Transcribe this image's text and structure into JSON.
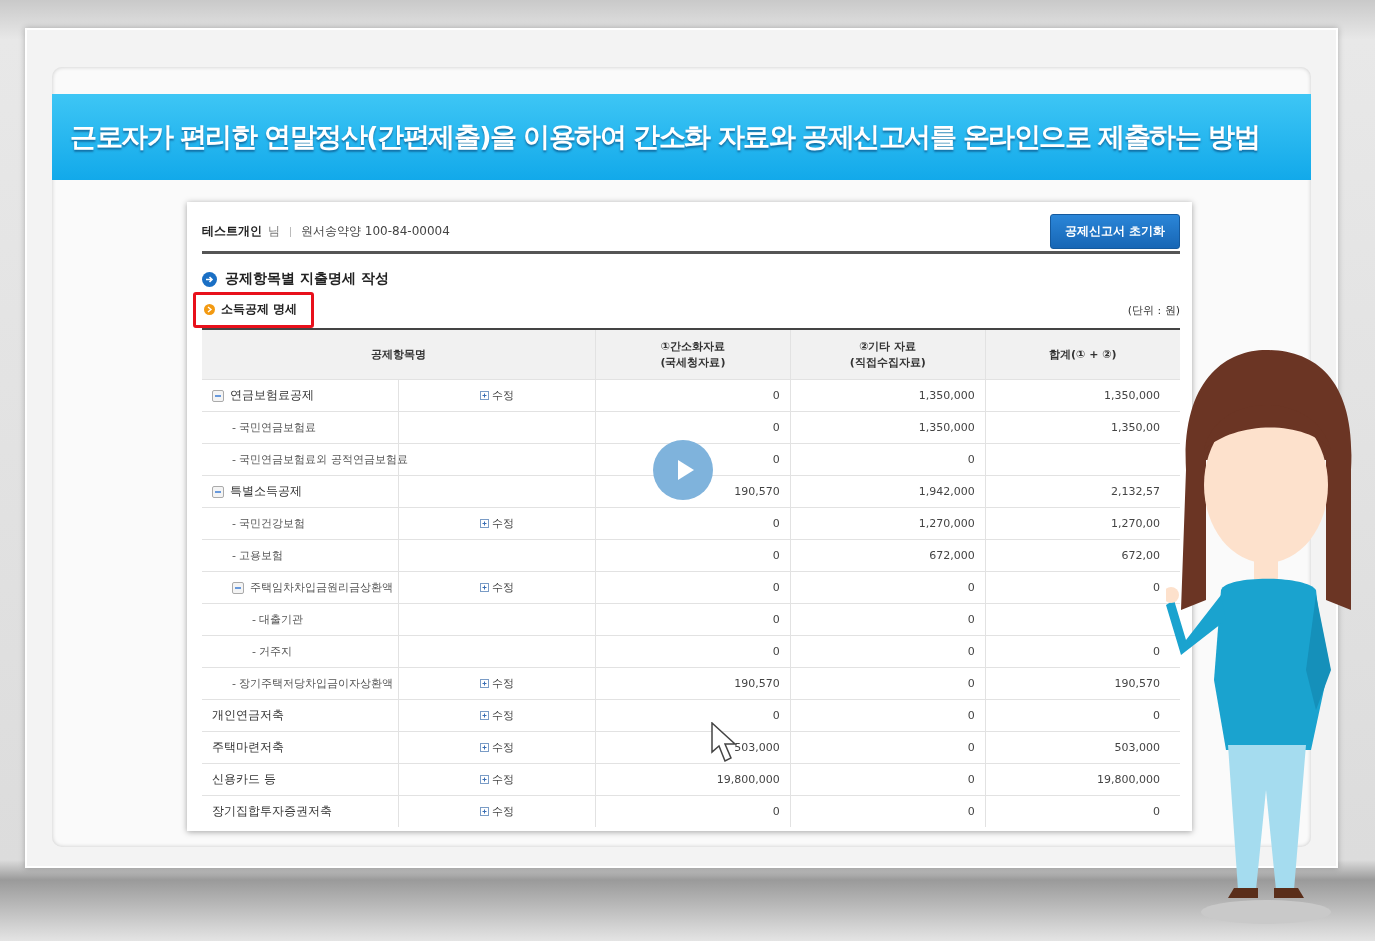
{
  "banner": {
    "title": "근로자가 편리한 연말정산(간편제출)을 이용하여 간소화 자료와 공제신고서를 온라인으로 제출하는 방법"
  },
  "header": {
    "user": "테스트개인",
    "honorific": "님",
    "account": "원서송약양 100-84-00004",
    "reset_button": "공제신고서 초기화"
  },
  "section": {
    "title": "공제항목별 지출명세 작성",
    "subsection": "소득공제 명세",
    "subsection_highlighted": true,
    "unit": "(단위 : 원)"
  },
  "table": {
    "columns": [
      {
        "lines": [
          "공제항목명"
        ]
      },
      {
        "lines": [
          "①간소화자료",
          "(국세청자료)"
        ]
      },
      {
        "lines": [
          "②기타 자료",
          "(직접수집자료)"
        ]
      },
      {
        "lines": [
          "합계(① + ②)"
        ]
      }
    ],
    "rows": [
      {
        "name": "연금보험료공제",
        "expanded": true,
        "edit": "수정",
        "values": [
          "0",
          "1,350,000",
          "1,350,000"
        ],
        "children": [
          {
            "name": "- 국민연금보험료",
            "values": [
              "0",
              "1,350,000",
              "1,350,00"
            ]
          },
          {
            "name": "- 국민연금보험료외 공적연금보험료",
            "values": [
              "0",
              "0"
            ]
          }
        ]
      },
      {
        "name": "특별소득공제",
        "expanded": true,
        "values": [
          "190,570",
          "1,942,000",
          "2,132,57"
        ],
        "children": [
          {
            "name": "- 국민건강보험",
            "edit": "수정",
            "values": [
              "0",
              "1,270,000",
              "1,270,00"
            ]
          },
          {
            "name": "- 고용보험",
            "values": [
              "0",
              "672,000",
              "672,00"
            ]
          },
          {
            "name": "주택임차차입금원리금상환액",
            "expanded": true,
            "edit": "수정",
            "values": [
              "0",
              "0",
              "0"
            ],
            "children": [
              {
                "name": "- 대출기관",
                "values": [
                  "0",
                  "0"
                ]
              },
              {
                "name": "- 거주지",
                "values": [
                  "0",
                  "0",
                  "0"
                ]
              }
            ]
          },
          {
            "name": "- 장기주택저당차입금이자상환액",
            "edit": "수정",
            "values": [
              "190,570",
              "0",
              "190,570"
            ]
          }
        ]
      },
      {
        "name": "개인연금저축",
        "edit": "수정",
        "values": [
          "0",
          "0",
          "0"
        ]
      },
      {
        "name": "주택마련저축",
        "edit": "수정",
        "values": [
          "503,000",
          "0",
          "503,000"
        ]
      },
      {
        "name": "신용카드 등",
        "edit": "수정",
        "values": [
          "19,800,000",
          "0",
          "19,800,000"
        ]
      },
      {
        "name": "장기집합투자증권저축",
        "edit": "수정",
        "values": [
          "0",
          "0",
          "0"
        ]
      }
    ]
  }
}
